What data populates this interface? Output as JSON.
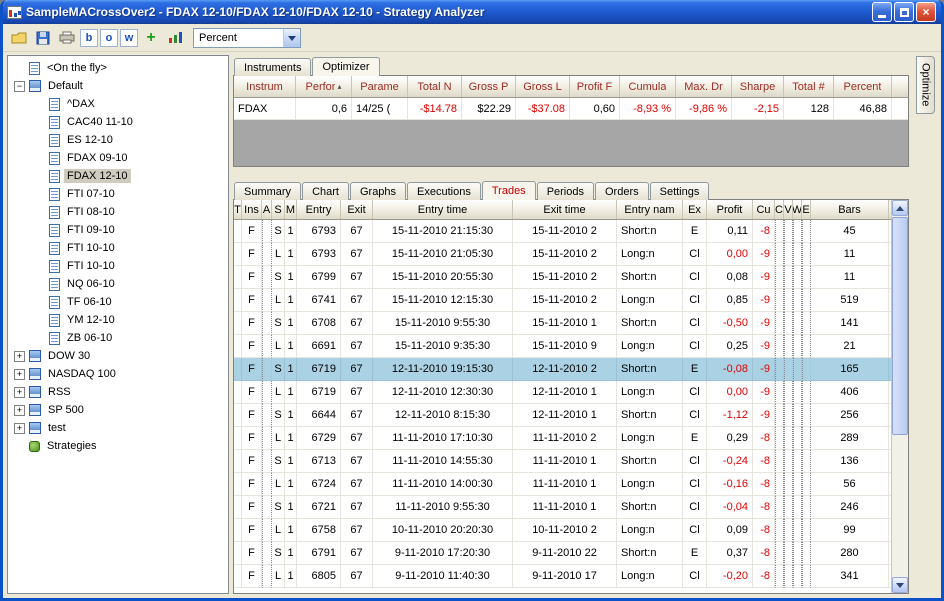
{
  "window": {
    "title": "SampleMACrossOver2 - FDAX 12-10/FDAX 12-10/FDAX 12-10 - Strategy Analyzer"
  },
  "toolbar": {
    "letter_buttons": [
      "b",
      "o",
      "w"
    ],
    "display_value": "Percent"
  },
  "right_tab_label": "Optimize",
  "top_tabs": [
    {
      "label": "Instruments",
      "selected": false
    },
    {
      "label": "Optimizer",
      "selected": true
    }
  ],
  "bottom_tabs": [
    {
      "label": "Summary",
      "selected": false
    },
    {
      "label": "Chart",
      "selected": false
    },
    {
      "label": "Graphs",
      "selected": false
    },
    {
      "label": "Executions",
      "selected": false
    },
    {
      "label": "Trades",
      "selected": true,
      "red": true
    },
    {
      "label": "Periods",
      "selected": false
    },
    {
      "label": "Orders",
      "selected": false
    },
    {
      "label": "Settings",
      "selected": false
    }
  ],
  "optimizer": {
    "columns": [
      "Instrum",
      "Perfor",
      "Parame",
      "Total N",
      "Gross P",
      "Gross L",
      "Profit F",
      "Cumula",
      "Max. Dr",
      "Sharpe",
      "Total #",
      "Percent"
    ],
    "sort_column_index": 1,
    "row": [
      {
        "v": "FDAX"
      },
      {
        "v": "0,6"
      },
      {
        "v": "14/25 ("
      },
      {
        "v": "-$14.78",
        "red": true
      },
      {
        "v": "$22.29"
      },
      {
        "v": "-$37.08",
        "red": true
      },
      {
        "v": "0,60"
      },
      {
        "v": "-8,93 %",
        "red": true
      },
      {
        "v": "-9,86 %",
        "red": true
      },
      {
        "v": "-2,15",
        "red": true
      },
      {
        "v": "128"
      },
      {
        "v": "46,88"
      }
    ]
  },
  "trades": {
    "columns": [
      "T",
      "Ins",
      "A",
      "S",
      "M",
      "Entry",
      "Exit",
      "Entry time",
      "Exit time",
      "Entry nam",
      "Ex",
      "Profit",
      "Cu",
      "C",
      "V",
      "W",
      "E",
      "Bars"
    ],
    "rows": [
      {
        "ins": "F",
        "side": "S",
        "qty": "1",
        "entry": "6793",
        "exit": "67",
        "entry_time": "15-11-2010 21:15:30",
        "exit_time": "15-11-2010 2",
        "entry_name": "Short:n",
        "ex": "E",
        "profit": "0,11",
        "profit_red": false,
        "cu": "-8",
        "bars": "45",
        "selected": false
      },
      {
        "ins": "F",
        "side": "L",
        "qty": "1",
        "entry": "6793",
        "exit": "67",
        "entry_time": "15-11-2010 21:05:30",
        "exit_time": "15-11-2010 2",
        "entry_name": "Long:n",
        "ex": "Cl",
        "profit": "0,00",
        "profit_red": true,
        "cu": "-9",
        "bars": "11",
        "selected": false
      },
      {
        "ins": "F",
        "side": "S",
        "qty": "1",
        "entry": "6799",
        "exit": "67",
        "entry_time": "15-11-2010 20:55:30",
        "exit_time": "15-11-2010 2",
        "entry_name": "Short:n",
        "ex": "Cl",
        "profit": "0,08",
        "profit_red": false,
        "cu": "-9",
        "bars": "11",
        "selected": false
      },
      {
        "ins": "F",
        "side": "L",
        "qty": "1",
        "entry": "6741",
        "exit": "67",
        "entry_time": "15-11-2010 12:15:30",
        "exit_time": "15-11-2010 2",
        "entry_name": "Long:n",
        "ex": "Cl",
        "profit": "0,85",
        "profit_red": false,
        "cu": "-9",
        "bars": "519",
        "selected": false
      },
      {
        "ins": "F",
        "side": "S",
        "qty": "1",
        "entry": "6708",
        "exit": "67",
        "entry_time": "15-11-2010 9:55:30",
        "exit_time": "15-11-2010 1",
        "entry_name": "Short:n",
        "ex": "Cl",
        "profit": "-0,50",
        "profit_red": true,
        "cu": "-9",
        "bars": "141",
        "selected": false
      },
      {
        "ins": "F",
        "side": "L",
        "qty": "1",
        "entry": "6691",
        "exit": "67",
        "entry_time": "15-11-2010 9:35:30",
        "exit_time": "15-11-2010 9",
        "entry_name": "Long:n",
        "ex": "Cl",
        "profit": "0,25",
        "profit_red": false,
        "cu": "-9",
        "bars": "21",
        "selected": false
      },
      {
        "ins": "F",
        "side": "S",
        "qty": "1",
        "entry": "6719",
        "exit": "67",
        "entry_time": "12-11-2010 19:15:30",
        "exit_time": "12-11-2010 2",
        "entry_name": "Short:n",
        "ex": "E",
        "profit": "-0,08",
        "profit_red": true,
        "cu": "-9",
        "bars": "165",
        "selected": true
      },
      {
        "ins": "F",
        "side": "L",
        "qty": "1",
        "entry": "6719",
        "exit": "67",
        "entry_time": "12-11-2010 12:30:30",
        "exit_time": "12-11-2010 1",
        "entry_name": "Long:n",
        "ex": "Cl",
        "profit": "0,00",
        "profit_red": true,
        "cu": "-9",
        "bars": "406",
        "selected": false
      },
      {
        "ins": "F",
        "side": "S",
        "qty": "1",
        "entry": "6644",
        "exit": "67",
        "entry_time": "12-11-2010 8:15:30",
        "exit_time": "12-11-2010 1",
        "entry_name": "Short:n",
        "ex": "Cl",
        "profit": "-1,12",
        "profit_red": true,
        "cu": "-9",
        "bars": "256",
        "selected": false
      },
      {
        "ins": "F",
        "side": "L",
        "qty": "1",
        "entry": "6729",
        "exit": "67",
        "entry_time": "11-11-2010 17:10:30",
        "exit_time": "11-11-2010 2",
        "entry_name": "Long:n",
        "ex": "E",
        "profit": "0,29",
        "profit_red": false,
        "cu": "-8",
        "bars": "289",
        "selected": false
      },
      {
        "ins": "F",
        "side": "S",
        "qty": "1",
        "entry": "6713",
        "exit": "67",
        "entry_time": "11-11-2010 14:55:30",
        "exit_time": "11-11-2010 1",
        "entry_name": "Short:n",
        "ex": "Cl",
        "profit": "-0,24",
        "profit_red": true,
        "cu": "-8",
        "bars": "136",
        "selected": false
      },
      {
        "ins": "F",
        "side": "L",
        "qty": "1",
        "entry": "6724",
        "exit": "67",
        "entry_time": "11-11-2010 14:00:30",
        "exit_time": "11-11-2010 1",
        "entry_name": "Long:n",
        "ex": "Cl",
        "profit": "-0,16",
        "profit_red": true,
        "cu": "-8",
        "bars": "56",
        "selected": false
      },
      {
        "ins": "F",
        "side": "S",
        "qty": "1",
        "entry": "6721",
        "exit": "67",
        "entry_time": "11-11-2010 9:55:30",
        "exit_time": "11-11-2010 1",
        "entry_name": "Short:n",
        "ex": "Cl",
        "profit": "-0,04",
        "profit_red": true,
        "cu": "-8",
        "bars": "246",
        "selected": false
      },
      {
        "ins": "F",
        "side": "L",
        "qty": "1",
        "entry": "6758",
        "exit": "67",
        "entry_time": "10-11-2010 20:20:30",
        "exit_time": "10-11-2010 2",
        "entry_name": "Long:n",
        "ex": "Cl",
        "profit": "0,09",
        "profit_red": false,
        "cu": "-8",
        "bars": "99",
        "selected": false
      },
      {
        "ins": "F",
        "side": "S",
        "qty": "1",
        "entry": "6791",
        "exit": "67",
        "entry_time": "9-11-2010 17:20:30",
        "exit_time": "9-11-2010 22",
        "entry_name": "Short:n",
        "ex": "E",
        "profit": "0,37",
        "profit_red": false,
        "cu": "-8",
        "bars": "280",
        "selected": false
      },
      {
        "ins": "F",
        "side": "L",
        "qty": "1",
        "entry": "6805",
        "exit": "67",
        "entry_time": "9-11-2010 11:40:30",
        "exit_time": "9-11-2010 17",
        "entry_name": "Long:n",
        "ex": "Cl",
        "profit": "-0,20",
        "profit_red": true,
        "cu": "-8",
        "bars": "341",
        "selected": false
      }
    ]
  },
  "sidebar": {
    "items": [
      {
        "label": "<On the fly>",
        "level": 0,
        "expander": "none",
        "icon": "doc",
        "selected": false
      },
      {
        "label": "Default",
        "level": 0,
        "expander": "minus",
        "icon": "book",
        "selected": false
      },
      {
        "label": "^DAX",
        "level": 1,
        "expander": "none",
        "icon": "doc",
        "selected": false
      },
      {
        "label": "CAC40 11-10",
        "level": 1,
        "expander": "none",
        "icon": "doc",
        "selected": false
      },
      {
        "label": "ES 12-10",
        "level": 1,
        "expander": "none",
        "icon": "doc",
        "selected": false
      },
      {
        "label": "FDAX 09-10",
        "level": 1,
        "expander": "none",
        "icon": "doc",
        "selected": false
      },
      {
        "label": "FDAX 12-10",
        "level": 1,
        "expander": "none",
        "icon": "doc",
        "selected": true
      },
      {
        "label": "FTI 07-10",
        "level": 1,
        "expander": "none",
        "icon": "doc",
        "selected": false
      },
      {
        "label": "FTI 08-10",
        "level": 1,
        "expander": "none",
        "icon": "doc",
        "selected": false
      },
      {
        "label": "FTI 09-10",
        "level": 1,
        "expander": "none",
        "icon": "doc",
        "selected": false
      },
      {
        "label": "FTI 10-10",
        "level": 1,
        "expander": "none",
        "icon": "doc",
        "selected": false
      },
      {
        "label": "FTI 10-10",
        "level": 1,
        "expander": "none",
        "icon": "doc",
        "selected": false
      },
      {
        "label": "NQ 06-10",
        "level": 1,
        "expander": "none",
        "icon": "doc",
        "selected": false
      },
      {
        "label": "TF 06-10",
        "level": 1,
        "expander": "none",
        "icon": "doc",
        "selected": false
      },
      {
        "label": "YM 12-10",
        "level": 1,
        "expander": "none",
        "icon": "doc",
        "selected": false
      },
      {
        "label": "ZB 06-10",
        "level": 1,
        "expander": "none",
        "icon": "doc",
        "selected": false
      },
      {
        "label": "DOW 30",
        "level": 0,
        "expander": "plus",
        "icon": "book",
        "selected": false
      },
      {
        "label": "NASDAQ 100",
        "level": 0,
        "expander": "plus",
        "icon": "book",
        "selected": false
      },
      {
        "label": "RSS",
        "level": 0,
        "expander": "plus",
        "icon": "book",
        "selected": false
      },
      {
        "label": "SP 500",
        "level": 0,
        "expander": "plus",
        "icon": "book",
        "selected": false
      },
      {
        "label": "test",
        "level": 0,
        "expander": "plus",
        "icon": "book",
        "selected": false
      },
      {
        "label": "Strategies",
        "level": 0,
        "expander": "none",
        "icon": "gear",
        "selected": false
      }
    ]
  }
}
